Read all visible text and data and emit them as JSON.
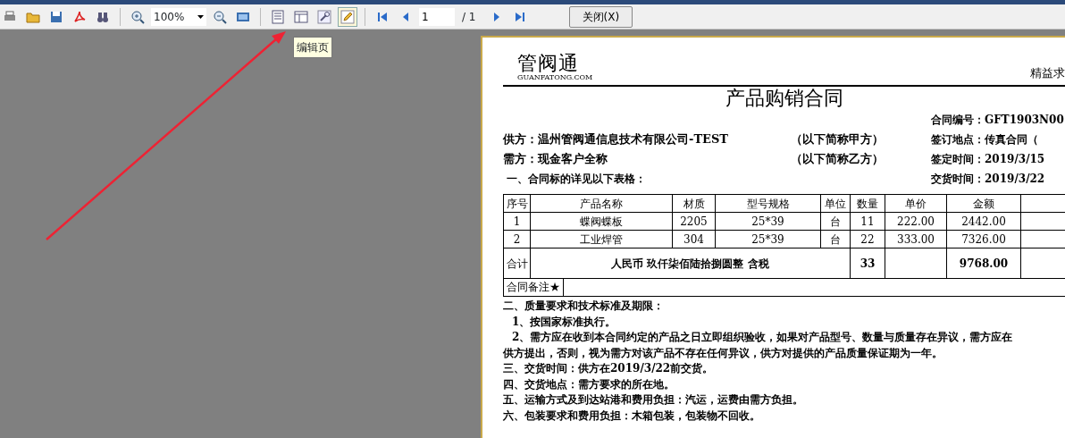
{
  "toolbar": {
    "zoom": "100%",
    "page_input": "1",
    "page_total": "/ 1",
    "close_button": "关闭(X)"
  },
  "tooltip": "编辑页",
  "document": {
    "logo": "管阀通",
    "logo_sub": "GUANFATONG.COM",
    "slogan": "精益求",
    "title": "产品购销合同",
    "contract_no": "合同编号：GFT1903N00",
    "parties": [
      {
        "text": "供方：温州管阀通信息技术有限公司-TEST",
        "note": "（以下简称甲方）",
        "info": "签订地点：传真合同（"
      },
      {
        "text": "需方：现金客户全称",
        "note": "（以下简称乙方）",
        "info": "签定时间：2019/3/15"
      }
    ],
    "section_1": "一、合同标的详见以下表格：",
    "delivery_info": "交货时间：2019/3/22",
    "table": {
      "columns": [
        "序号",
        "产品名称",
        "材质",
        "型号规格",
        "单位",
        "数量",
        "单价",
        "金额"
      ],
      "rows": [
        [
          "1",
          "蝶阀蝶板",
          "2205",
          "25*39",
          "台",
          "11",
          "222.00",
          "2442.00"
        ],
        [
          "2",
          "工业焊管",
          "304",
          "25*39",
          "台",
          "22",
          "333.00",
          "7326.00"
        ]
      ],
      "total": {
        "label": "合计",
        "amount_words": "人民币 玖仟柒佰陆拾捌圆整 含税",
        "quantity": "33",
        "amount": "9768.00"
      },
      "remark_label": "合同备注★"
    },
    "clauses": [
      {
        "kind": "heading",
        "text": "二、质量要求和技术标准及期限："
      },
      {
        "kind": "item",
        "text": "1、按国家标准执行。"
      },
      {
        "kind": "item",
        "text": "2、需方应在收到本合同约定的产品之日立即组织验收，如果对产品型号、数量与质量存在异议，需方应在"
      },
      {
        "kind": "heading",
        "text": "供方提出，否则，视为需方对该产品不存在任何异议，供方对提供的产品质量保证期为一年。"
      },
      {
        "kind": "heading",
        "text": "三、交货时间：供方在2019/3/22前交货。"
      },
      {
        "kind": "heading",
        "text": "四、交货地点：需方要求的所在地。"
      },
      {
        "kind": "heading",
        "text": "五、运输方式及到达站港和费用负担：汽运，运费由需方负担。"
      },
      {
        "kind": "heading",
        "text": "六、包装要求和费用负担：木箱包装，包装物不回收。"
      }
    ]
  }
}
